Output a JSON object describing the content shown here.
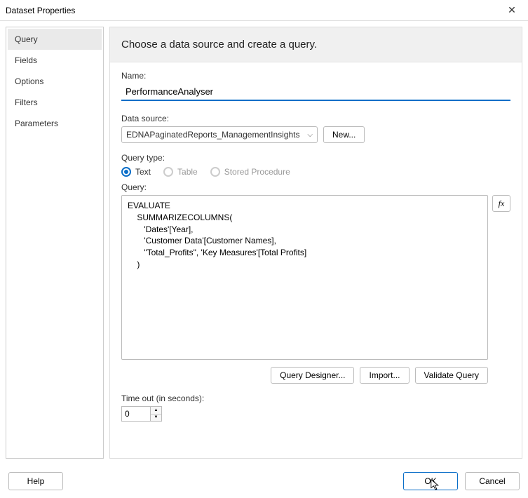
{
  "window": {
    "title": "Dataset Properties"
  },
  "sidebar": {
    "items": [
      {
        "label": "Query",
        "active": true
      },
      {
        "label": "Fields"
      },
      {
        "label": "Options"
      },
      {
        "label": "Filters"
      },
      {
        "label": "Parameters"
      }
    ]
  },
  "main": {
    "heading": "Choose a data source and create a query.",
    "name_label": "Name:",
    "name_value": "PerformanceAnalyser",
    "datasource_label": "Data source:",
    "datasource_value": "EDNAPaginatedReports_ManagementInsights",
    "new_button": "New...",
    "querytype_label": "Query type:",
    "querytype_options": {
      "text": "Text",
      "table": "Table",
      "stored": "Stored Procedure"
    },
    "query_label": "Query:",
    "query_text": "EVALUATE\n    SUMMARIZECOLUMNS(\n       'Dates'[Year],\n       'Customer Data'[Customer Names],\n       \"Total_Profits\", 'Key Measures'[Total Profits]\n    )",
    "fx_button": "fx",
    "actions": {
      "designer": "Query Designer...",
      "import": "Import...",
      "validate": "Validate Query"
    },
    "timeout_label": "Time out (in seconds):",
    "timeout_value": "0"
  },
  "footer": {
    "help": "Help",
    "ok": "OK",
    "cancel": "Cancel"
  }
}
